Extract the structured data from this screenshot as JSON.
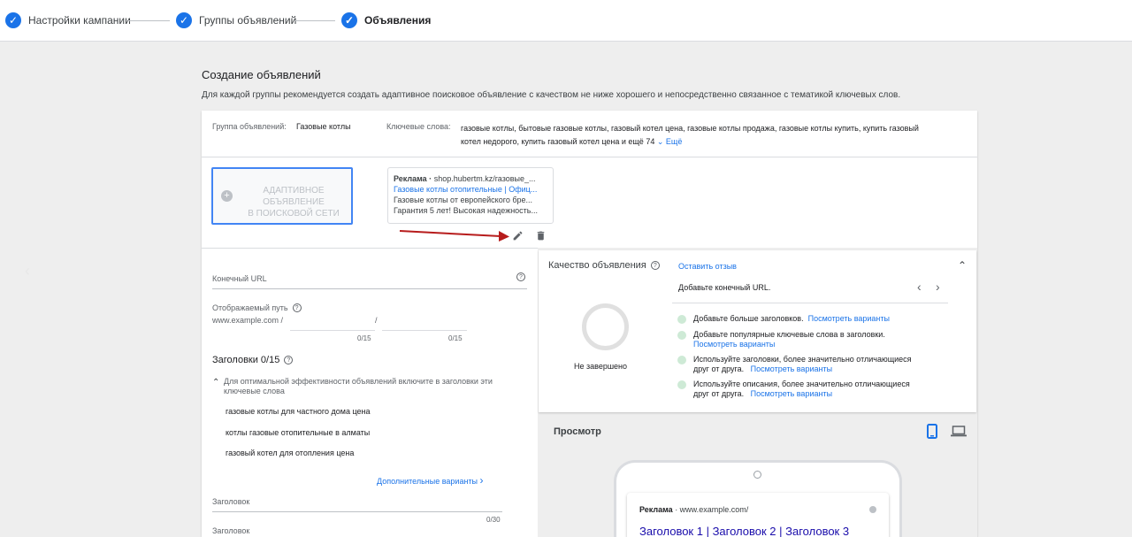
{
  "stepper": {
    "steps": [
      {
        "label": "Настройки кампании"
      },
      {
        "label": "Группы объявлений"
      },
      {
        "label": "Объявления"
      }
    ]
  },
  "page": {
    "title": "Создание объявлений",
    "description": "Для каждой группы рекомендуется создать адаптивное поисковое объявление с качеством не ниже хорошего и непосредственно связанное с тематикой ключевых слов."
  },
  "adgroup": {
    "group_label": "Группа объявлений:",
    "group_value": "Газовые котлы",
    "keywords_label": "Ключевые слова:",
    "keywords_line1": "газовые котлы, бытовые газовые котлы, газовый котел цена, газовые котлы продажа, газовые котлы купить, купить газовый",
    "keywords_line2": "котел недорого, купить газовый котел цена и ещё 74",
    "more_label": "Ещё"
  },
  "ads": {
    "new_ad_line1": "АДАПТИВНОЕ ОБЪЯВЛЕНИЕ",
    "new_ad_line2": "В ПОИСКОВОЙ СЕТИ",
    "preview_ad_badge": "Реклама ·",
    "preview_url": "shop.hubertm.kz/газовые_...",
    "preview_headline": "Газовые котлы отопительные | Офиц...",
    "preview_desc1": "Газовые котлы от европейского бре...",
    "preview_desc2": "Гарантия 5 лет! Высокая надежность..."
  },
  "form": {
    "final_url_label": "Конечный URL",
    "display_path_label": "Отображаемый путь",
    "display_path_prefix": "www.example.com /",
    "path_separator": "/",
    "path1_counter": "0/15",
    "path2_counter": "0/15",
    "headlines_title": "Заголовки 0/15",
    "hint_text_line1": "Для оптимальной эффективности объявлений включите в заголовки эти",
    "hint_text_line2": "ключевые слова",
    "suggestions": [
      "газовые котлы для частного дома цена",
      "котлы газовые отопительные в алматы",
      "газовый котел для отопления цена"
    ],
    "more_options": "Дополнительные варианты",
    "headline_label_1": "Заголовок",
    "headline_counter_1": "0/30",
    "headline_label_2": "Заголовок"
  },
  "quality": {
    "title": "Качество объявления",
    "feedback_link": "Оставить отзыв",
    "final_url_hint": "Добавьте конечный URL.",
    "status": "Не завершено",
    "items": [
      {
        "text": "Добавьте больше заголовков.",
        "link": "Посмотреть варианты"
      },
      {
        "text": "Добавьте популярные ключевые слова в заголовки.",
        "link": "Посмотреть варианты"
      },
      {
        "text": "Используйте заголовки, более значительно отличающиеся",
        "text2": "друг от друга.",
        "link": "Посмотреть варианты"
      },
      {
        "text": "Используйте описания, более значительно отличающиеся",
        "text2": "друг от друга.",
        "link": "Посмотреть варианты"
      }
    ]
  },
  "preview": {
    "title": "Просмотр",
    "ad_badge": "Реклама",
    "url": "· www.example.com/",
    "headline": "Заголовок 1 | Заголовок 2 | Заголовок 3"
  },
  "colors": {
    "accent": "#1a73e8",
    "arrow": "#b71c1c",
    "ring": "#e0e0e0",
    "dot": "#ceead6"
  }
}
